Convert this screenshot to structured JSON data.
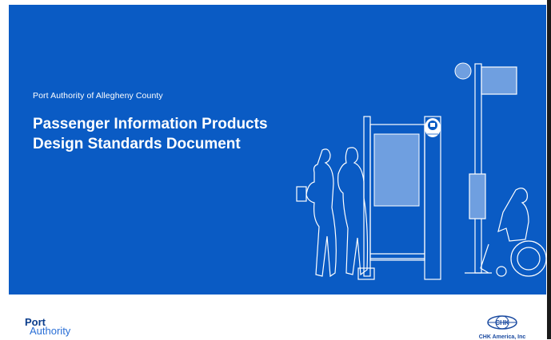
{
  "cover": {
    "organization": "Port Authority of Allegheny County",
    "title_line1": "Passenger Information Products",
    "title_line2": "Design Standards Document"
  },
  "logos": {
    "port_authority_line1": "Port",
    "port_authority_line2": "Authority",
    "chk_name": "CHK America, Inc",
    "chk_mark": "CHK"
  },
  "colors": {
    "banner_blue": "#0a5bc4",
    "panel_blue": "#6f9fe0",
    "brand_navy": "#0b3d8c"
  }
}
